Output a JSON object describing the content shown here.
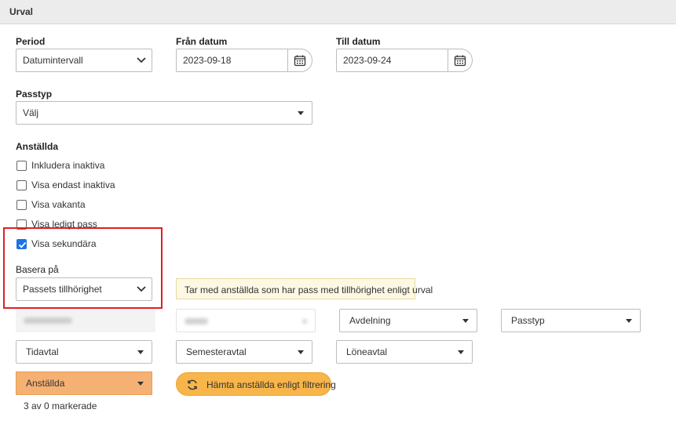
{
  "panel": {
    "title": "Urval"
  },
  "period": {
    "label": "Period",
    "value": "Datumintervall"
  },
  "from_date": {
    "label": "Från datum",
    "value": "2023-09-18"
  },
  "to_date": {
    "label": "Till datum",
    "value": "2023-09-24"
  },
  "pass_type": {
    "label": "Passtyp",
    "value": "Välj"
  },
  "employees": {
    "label": "Anställda",
    "checkboxes": [
      {
        "label": "Inkludera inaktiva",
        "checked": false
      },
      {
        "label": "Visa endast inaktiva",
        "checked": false
      },
      {
        "label": "Visa vakanta",
        "checked": false
      },
      {
        "label": "Visa ledigt pass",
        "checked": false
      },
      {
        "label": "Visa sekundära",
        "checked": true
      }
    ]
  },
  "base_on": {
    "label": "Basera på",
    "value": "Passets tillhörighet"
  },
  "info_text": "Tar med anställda som har pass med tillhörighet enligt urval",
  "filters": {
    "department": "Avdelning",
    "pass_type": "Passtyp",
    "time_agreement": "Tidavtal",
    "vacation_agreement": "Semesteravtal",
    "salary_agreement": "Löneavtal",
    "employees": "Anställda"
  },
  "fetch_button": "Hämta anställda enligt filtrering",
  "selected_count": "3 av 0 markerade",
  "colors": {
    "accent_orange": "#f7b54a",
    "highlight_red": "#e02020",
    "checkbox_blue": "#1a73e8"
  }
}
